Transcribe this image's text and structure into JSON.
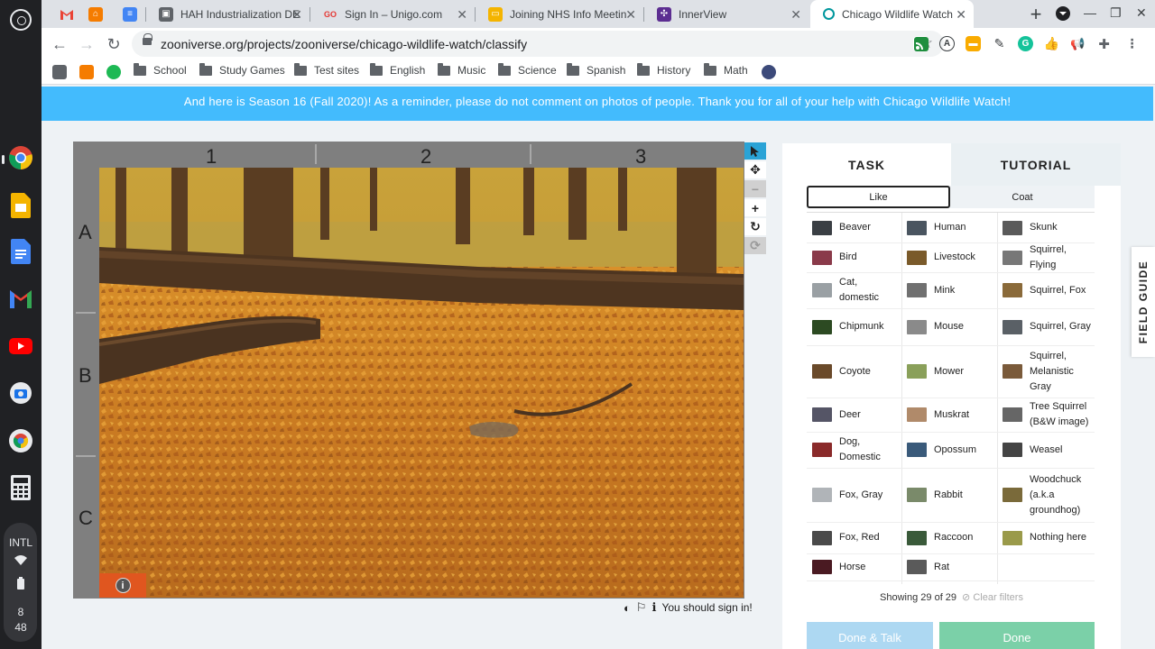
{
  "shelf": {
    "status": {
      "ime": "INTL",
      "time_hour": "8",
      "time_min": "48"
    }
  },
  "tabs": [
    {
      "title": "",
      "favicon": "gmail-icon"
    },
    {
      "title": "",
      "favicon": "orange-house-icon"
    },
    {
      "title": "",
      "favicon": "docs-icon"
    },
    {
      "title": "HAH Industrialization DE",
      "favicon": "classroom-icon"
    },
    {
      "title": "Sign In – Unigo.com",
      "favicon": "unigo-icon"
    },
    {
      "title": "Joining NHS Info Meetin",
      "favicon": "slides-icon"
    },
    {
      "title": "InnerView",
      "favicon": "innerview-icon"
    },
    {
      "title": "Chicago Wildlife Watch",
      "favicon": "zooniverse-icon",
      "active": true
    }
  ],
  "address": {
    "url": "zooniverse.org/projects/zooniverse/chicago-wildlife-watch/classify"
  },
  "bookmarks": [
    {
      "label": "School"
    },
    {
      "label": "Study Games"
    },
    {
      "label": "Test sites"
    },
    {
      "label": "English"
    },
    {
      "label": "Music"
    },
    {
      "label": "Science"
    },
    {
      "label": "Spanish"
    },
    {
      "label": "History"
    },
    {
      "label": "Math"
    }
  ],
  "banner": {
    "text": "And here is Season 16 (Fall 2020)! As a reminder, please do not comment on photos of people. Thank you for all of your help with Chicago Wildlife Watch!"
  },
  "viewer": {
    "columns": [
      "1",
      "2",
      "3"
    ],
    "rows": [
      "A",
      "B",
      "C"
    ],
    "sign_in_note": "You should sign in!"
  },
  "task_panel": {
    "tab_task": "TASK",
    "tab_tutorial": "TUTORIAL",
    "filter_like": "Like",
    "filter_coat": "Coat",
    "choices": [
      [
        "Beaver",
        "Human",
        "Skunk"
      ],
      [
        "Bird",
        "Livestock",
        "Squirrel, Flying"
      ],
      [
        "Cat, domestic",
        "Mink",
        "Squirrel, Fox"
      ],
      [
        "Chipmunk",
        "Mouse",
        "Squirrel, Gray"
      ],
      [
        "Coyote",
        "Mower",
        "Squirrel, Melanistic Gray"
      ],
      [
        "Deer",
        "Muskrat",
        "Tree Squirrel (B&W image)"
      ],
      [
        "Dog, Domestic",
        "Opossum",
        "Weasel"
      ],
      [
        "Fox, Gray",
        "Rabbit",
        "Woodchuck (a.k.a groundhog)"
      ],
      [
        "Fox, Red",
        "Raccoon",
        "Nothing here"
      ],
      [
        "Horse",
        "Rat",
        ""
      ]
    ],
    "showing": "Showing 29 of 29",
    "clear_filters": "Clear filters",
    "done_talk": "Done & Talk",
    "done": "Done"
  },
  "field_guide": "FIELD GUIDE",
  "colors": {
    "banner": "#43bbfd",
    "done_talk": "#add8f2",
    "done": "#7bd0a8",
    "active_tool": "#2aa3d6"
  }
}
